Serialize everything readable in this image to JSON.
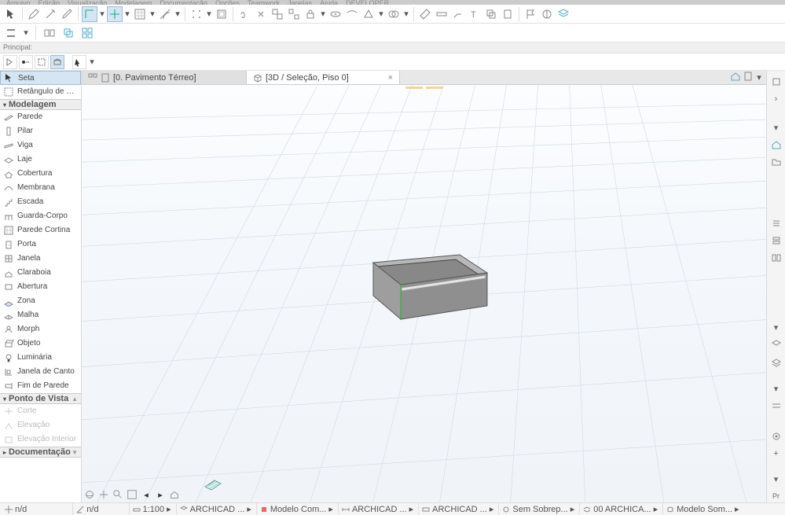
{
  "menu": [
    "Arquivo",
    "Edição",
    "Visualização",
    "Modelagem",
    "Documentação",
    "Opções",
    "Teamwork",
    "Janelas",
    "Ajuda",
    "DEVELOPER"
  ],
  "label_bar": "Principal:",
  "tabs": [
    {
      "icon": "floor",
      "label": "[0. Pavimento Térreo]",
      "active": false,
      "closeable": false
    },
    {
      "icon": "3d",
      "label": "[3D / Seleção, Piso 0]",
      "active": true,
      "closeable": true
    }
  ],
  "toolbox": {
    "selection_group": "",
    "items_top": [
      {
        "icon": "arrow",
        "label": "Seta",
        "selected": true
      },
      {
        "icon": "marquee",
        "label": "Retângulo de Seleção"
      }
    ],
    "group_modelagem": "Modelagem",
    "items_model": [
      {
        "icon": "wall",
        "label": "Parede"
      },
      {
        "icon": "pillar",
        "label": "Pilar"
      },
      {
        "icon": "beam",
        "label": "Viga"
      },
      {
        "icon": "slab",
        "label": "Laje"
      },
      {
        "icon": "roof",
        "label": "Cobertura"
      },
      {
        "icon": "membrane",
        "label": "Membrana"
      },
      {
        "icon": "stair",
        "label": "Escada"
      },
      {
        "icon": "rail",
        "label": "Guarda-Corpo"
      },
      {
        "icon": "curtain",
        "label": "Parede Cortina"
      },
      {
        "icon": "door",
        "label": "Porta"
      },
      {
        "icon": "window",
        "label": "Janela"
      },
      {
        "icon": "skylight",
        "label": "Claraboia"
      },
      {
        "icon": "opening",
        "label": "Abertura"
      },
      {
        "icon": "zone",
        "label": "Zona"
      },
      {
        "icon": "mesh",
        "label": "Malha"
      },
      {
        "icon": "morph",
        "label": "Morph"
      },
      {
        "icon": "object",
        "label": "Objeto"
      },
      {
        "icon": "lamp",
        "label": "Luminária"
      },
      {
        "icon": "cornerwin",
        "label": "Janela de Canto"
      },
      {
        "icon": "wallend",
        "label": "Fim de Parede"
      }
    ],
    "group_pov": "Ponto de Vista",
    "items_pov": [
      {
        "icon": "section",
        "label": "Corte",
        "disabled": true
      },
      {
        "icon": "elev",
        "label": "Elevação",
        "disabled": true
      },
      {
        "icon": "ielev",
        "label": "Elevação Interior",
        "disabled": true
      }
    ],
    "group_doc": "Documentação"
  },
  "status": {
    "fields": [
      {
        "i": "cursor",
        "v": "n/d"
      },
      {
        "i": "angle",
        "v": "n/d"
      },
      {
        "i": "scale",
        "v": "1:100"
      },
      {
        "i": "layers",
        "v": "ARCHICAD ..."
      },
      {
        "i": "pen",
        "v": "Modelo Com..."
      },
      {
        "i": "dim",
        "v": "ARCHICAD ..."
      },
      {
        "i": "struct",
        "v": "ARCHICAD ..."
      },
      {
        "i": "over",
        "v": "Sem Sobrep..."
      },
      {
        "i": "layers2",
        "v": "00 ARCHICA..."
      },
      {
        "i": "model",
        "v": "Modelo Som..."
      }
    ]
  },
  "prop_label": "Pr"
}
